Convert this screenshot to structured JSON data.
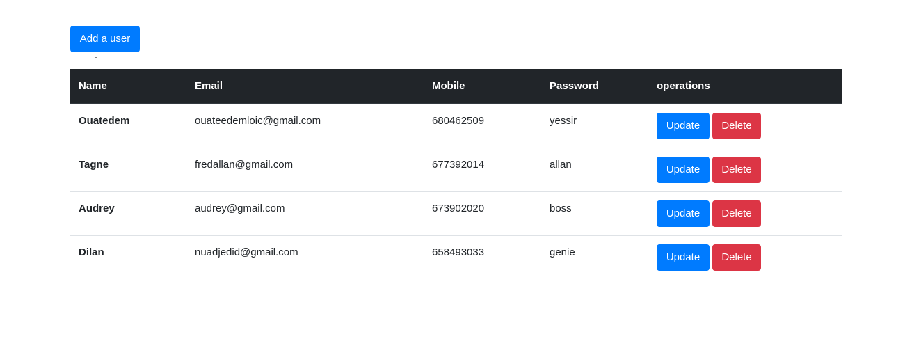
{
  "toolbar": {
    "add_user_label": "Add a user"
  },
  "table": {
    "headers": [
      "Name",
      "Email",
      "Mobile",
      "Password",
      "operations"
    ],
    "rows": [
      {
        "name": "Ouatedem",
        "email": "ouateedemloic@gmail.com",
        "mobile": "680462509",
        "password": "yessir"
      },
      {
        "name": "Tagne",
        "email": "fredallan@gmail.com",
        "mobile": "677392014",
        "password": "allan"
      },
      {
        "name": "Audrey",
        "email": "audrey@gmail.com",
        "mobile": "673902020",
        "password": "boss"
      },
      {
        "name": "Dilan",
        "email": "nuadjedid@gmail.com",
        "mobile": "658493033",
        "password": "genie"
      }
    ],
    "update_label": "Update",
    "delete_label": "Delete"
  },
  "colors": {
    "primary": "#007bff",
    "danger": "#dc3545",
    "header_bg": "#212529"
  }
}
